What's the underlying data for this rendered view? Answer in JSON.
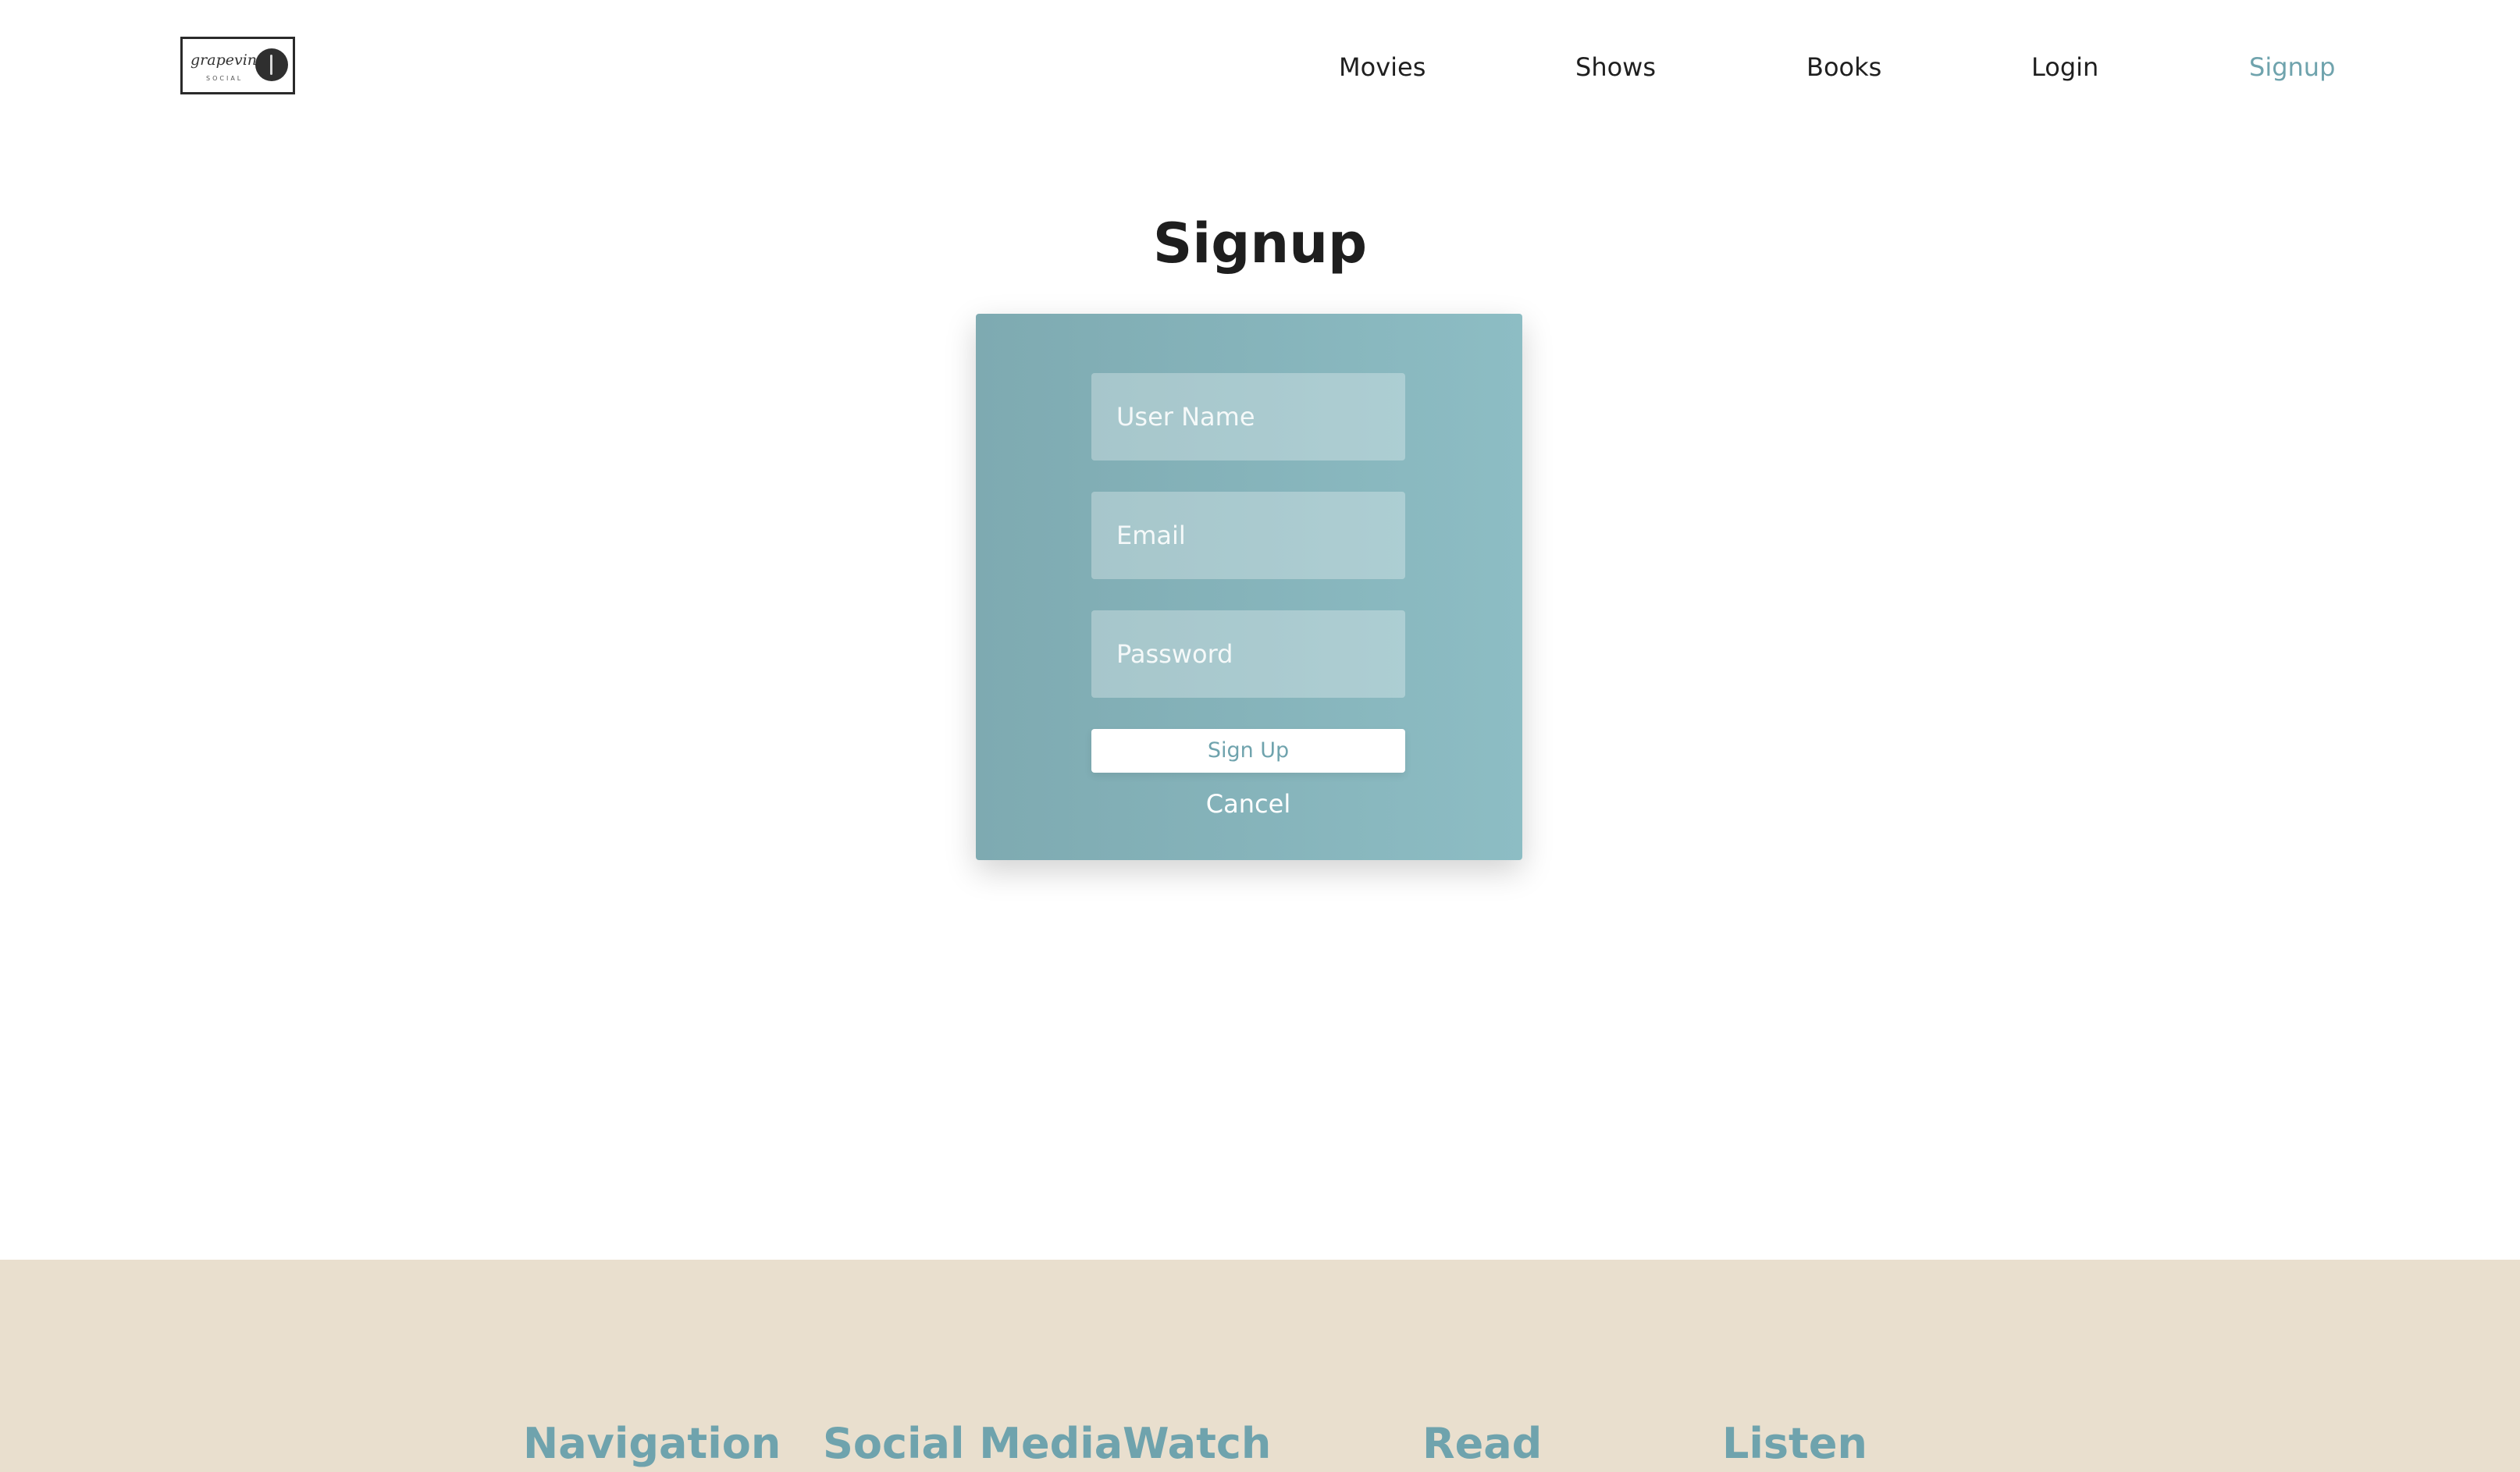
{
  "header": {
    "logo": {
      "script_text": "grapevine",
      "sub_text": "SOCIAL"
    },
    "nav": [
      {
        "label": "Movies"
      },
      {
        "label": "Shows"
      },
      {
        "label": "Books"
      },
      {
        "label": "Login"
      },
      {
        "label": "Signup",
        "active": true
      }
    ]
  },
  "main": {
    "title": "Signup",
    "form": {
      "username_placeholder": "User Name",
      "email_placeholder": "Email",
      "password_placeholder": "Password",
      "submit_label": "Sign Up",
      "cancel_label": "Cancel"
    }
  },
  "footer": {
    "columns": [
      {
        "heading": "Navigation"
      },
      {
        "heading": "Social Media"
      },
      {
        "heading": "Watch"
      },
      {
        "heading": "Read"
      },
      {
        "heading": "Listen"
      }
    ]
  },
  "colors": {
    "accent": "#6fa3ad",
    "card_gradient_start": "#7eaab1",
    "card_gradient_end": "#8dbdc4",
    "footer_background": "#e9dfce",
    "text": "#1e1e1e"
  }
}
